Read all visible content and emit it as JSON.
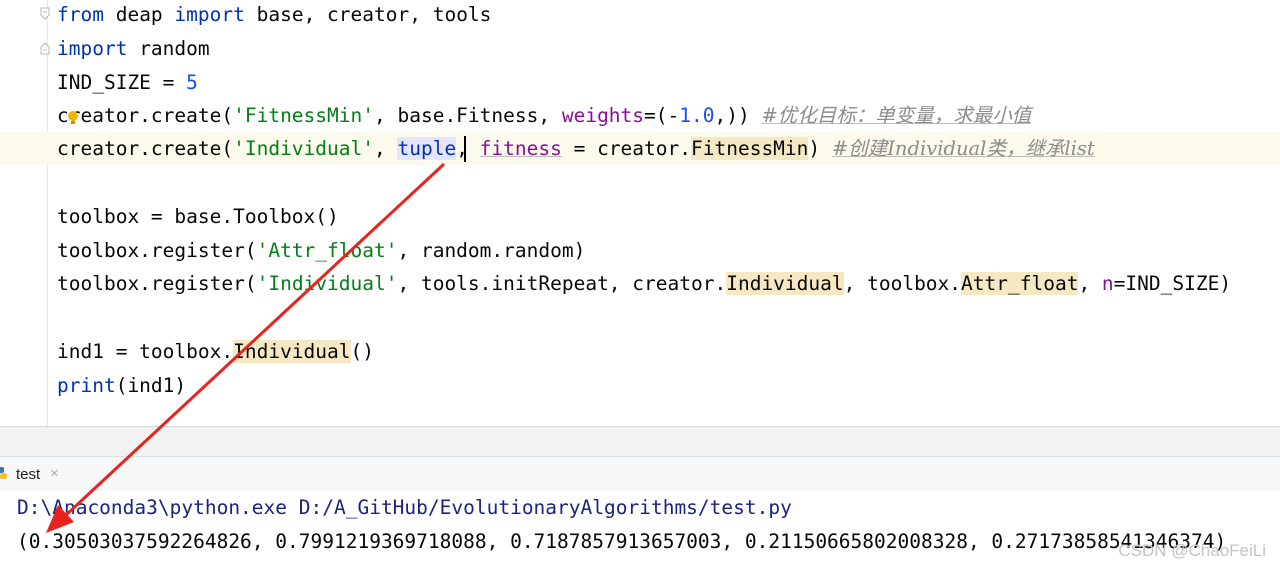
{
  "editor": {
    "line1": {
      "kw1": "from",
      "t1": " deap ",
      "kw2": "import",
      "t2": " base, creator, tools"
    },
    "line2": {
      "kw": "import",
      "t": " random"
    },
    "line3": {
      "t": "IND_SIZE = ",
      "num": "5"
    },
    "line4": {
      "t1": "creator.create(",
      "s": "'FitnessMin'",
      "t2": ", base.Fitness, ",
      "p": "weights",
      "t3": "=(-",
      "num": "1.0",
      "t4": ",)) ",
      "c": "#优化目标：单变量，求最小值"
    },
    "line5": {
      "t1": "creator.create(",
      "s": "'Individual'",
      "t2": ", ",
      "tuple": "tuple",
      "t3": ", ",
      "p": "fitness",
      "t4": " = creator.",
      "hl": "FitnessMin",
      "t5": ") ",
      "c": "#创建Individual类，继承list"
    },
    "line7": {
      "t": "toolbox = base.Toolbox()"
    },
    "line8": {
      "t1": "toolbox.register(",
      "s": "'Attr_float'",
      "t2": ", random.random)"
    },
    "line9": {
      "t1": "toolbox.register(",
      "s": "'Individual'",
      "t2": ", tools.initRepeat, creator.",
      "hl1": "Individual",
      "t3": ", toolbox.",
      "hl2": "Attr_float",
      "t4": ", ",
      "p": "n",
      "t5": "=IND_SIZE)"
    },
    "line11": {
      "t1": "ind1 = toolbox.",
      "hl": "Individual",
      "t2": "()"
    },
    "line12": {
      "kw": "print",
      "t": "(ind1)"
    }
  },
  "run_panel": {
    "tab_label": "test",
    "tab_close": "×",
    "command": "D:\\Anaconda3\\python.exe D:/A_GitHub/EvolutionaryAlgorithms/test.py",
    "output": "(0.30503037592264826, 0.7991219369718088, 0.7187857913657003, 0.21150665802008328, 0.27173858541346374)"
  },
  "watermark": "CSDN @ChaoFeiLi",
  "colors": {
    "keyword": "#0033b3",
    "string": "#067d17",
    "number": "#1750eb",
    "param": "#871094",
    "comment": "#8c8c8c",
    "arrow": "#e8231d"
  },
  "icons": [
    "fold-icon",
    "intention-bulb-icon",
    "python-file-icon",
    "close-icon"
  ]
}
